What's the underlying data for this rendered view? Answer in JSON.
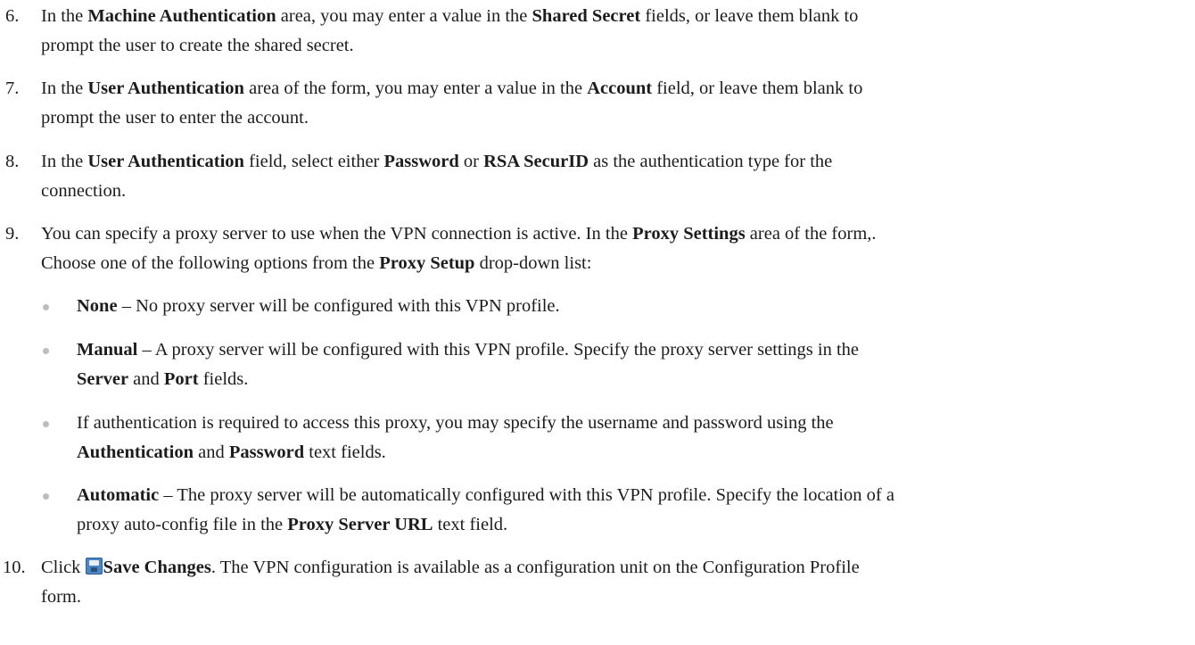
{
  "steps": [
    {
      "num": "6.",
      "p1": "In the ",
      "b1": "Machine Authentication",
      "p2": " area, you may enter a value in the ",
      "b2": "Shared Secret",
      "p3": " fields, or leave them blank to",
      "line2": "prompt the user to create the shared secret."
    },
    {
      "num": "7.",
      "p1": "In the ",
      "b1": "User Authentication",
      "p2": " area of the form, you may enter a value in the ",
      "b2": "Account",
      "p3": " field, or leave them blank to",
      "line2": "prompt the user to enter the account."
    },
    {
      "num": "8.",
      "p1": "In the ",
      "b1": "User Authentication",
      "p2": " field, select either ",
      "b2": "Password",
      "p3": " or ",
      "b3": "RSA SecurID",
      "p4": " as the authentication type for the",
      "line2": "connection."
    },
    {
      "num": "9.",
      "p1": "You can specify a proxy server to use when the VPN connection is active. In the ",
      "b1": "Proxy Settings",
      "p2": " area of the form,.",
      "l2a": "Choose one of the following options from the ",
      "l2b": "Proxy Setup",
      "l2c": " drop-down list:"
    },
    {
      "num": "10.",
      "p1": "Click ",
      "save_icon": "save-icon",
      "b1": "Save Changes",
      "p2": ". The VPN configuration is available as a configuration unit on the Configuration Profile",
      "line2": "form."
    }
  ],
  "bullets": [
    {
      "b1": "None",
      "p1": " – No proxy server will be configured with this VPN profile."
    },
    {
      "b1": "Manual",
      "p1": " – A proxy server will be configured with this VPN profile. Specify the proxy server settings in the",
      "b2": "Server",
      "p2": " and ",
      "b3": "Port",
      "p3": " fields."
    },
    {
      "p1": "If authentication is required to access this proxy, you may specify the username and password using the",
      "b1": "Authentication",
      "p2": " and ",
      "b2": "Password",
      "p3": " text fields."
    },
    {
      "b1": "Automatic",
      "p1": " – The proxy server will be automatically configured with this VPN profile. Specify the location of a",
      "p2": "proxy auto-config file in the ",
      "b2": "Proxy Server URL",
      "p3": " text field."
    }
  ],
  "colors": {
    "text": "#1c1c1c",
    "bullet": "#bdbdbd",
    "save_icon": "#4b86c4"
  }
}
